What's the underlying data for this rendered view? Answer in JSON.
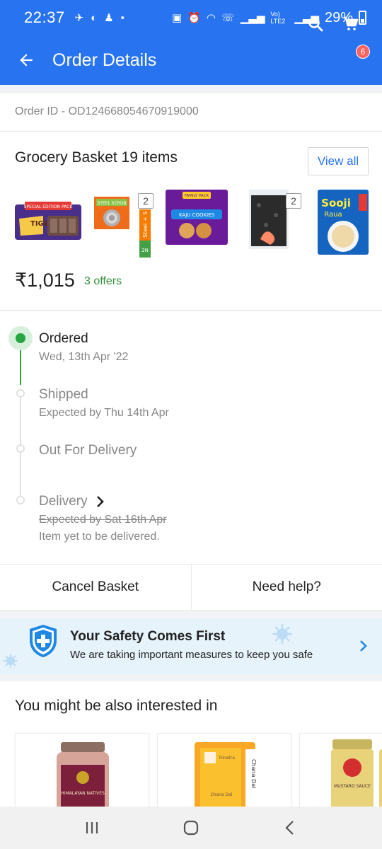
{
  "status_bar": {
    "time": "22:37",
    "network": "Vo) LTE2",
    "battery": "29%"
  },
  "app_bar": {
    "title": "Order Details",
    "cart_count": "6",
    "icons": [
      "back-arrow-icon",
      "search-icon",
      "cart-icon"
    ]
  },
  "order": {
    "id_text": "Order ID - OD124668054670919000"
  },
  "basket": {
    "title": "Grocery Basket 19 items",
    "view_all": "View all",
    "price": "₹1,015",
    "offers": "3 offers",
    "products": [
      {
        "name": "Tiger biscuit pack",
        "badge": "SPECIAL EDITION PACK",
        "label": "TIGER"
      },
      {
        "name": "Steel scrub",
        "label": "STEEL SCRUB",
        "qty": "2"
      },
      {
        "name": "Steel + S (2N)",
        "label": "Steel + S",
        "sub": "2N"
      },
      {
        "name": "Kaju Cookies family pack",
        "badge": "FAMILY PACK",
        "label": "KAJU COOKIES"
      },
      {
        "name": "Dark spice packet",
        "qty": "2"
      },
      {
        "name": "Sooji Raua",
        "label": "Sooji",
        "sub": "Raua"
      }
    ]
  },
  "tracking": {
    "steps": [
      {
        "title": "Ordered",
        "subtitle": "Wed, 13th Apr '22",
        "status": "done"
      },
      {
        "title": "Shipped",
        "subtitle": "Expected by Thu 14th Apr",
        "status": "pending"
      },
      {
        "title": "Out For Delivery",
        "subtitle": "",
        "status": "pending"
      },
      {
        "title": "Delivery",
        "subtitle_struck": "Expected by Sat 16th Apr",
        "note": "Item yet to be delivered.",
        "status": "pending"
      }
    ]
  },
  "actions": {
    "cancel": "Cancel Basket",
    "help": "Need help?"
  },
  "safety": {
    "title": "Your Safety Comes First",
    "subtitle": "We are taking important measures to keep you safe"
  },
  "recommendations": {
    "title": "You might be also interested in",
    "items": [
      {
        "name": "Himalayan Natives jar",
        "label": "HIMALAYAN NATIVES"
      },
      {
        "name": "Chana Dal pack",
        "label": "Chana Dal",
        "brand": "Trinetra"
      },
      {
        "name": "Mustard sauce jar",
        "label": "MUSTARD SAUCE"
      }
    ]
  },
  "colors": {
    "brand_blue": "#2874f0",
    "success_green": "#26a541",
    "offer_green": "#388e3c",
    "badge_red": "#ff6161"
  }
}
